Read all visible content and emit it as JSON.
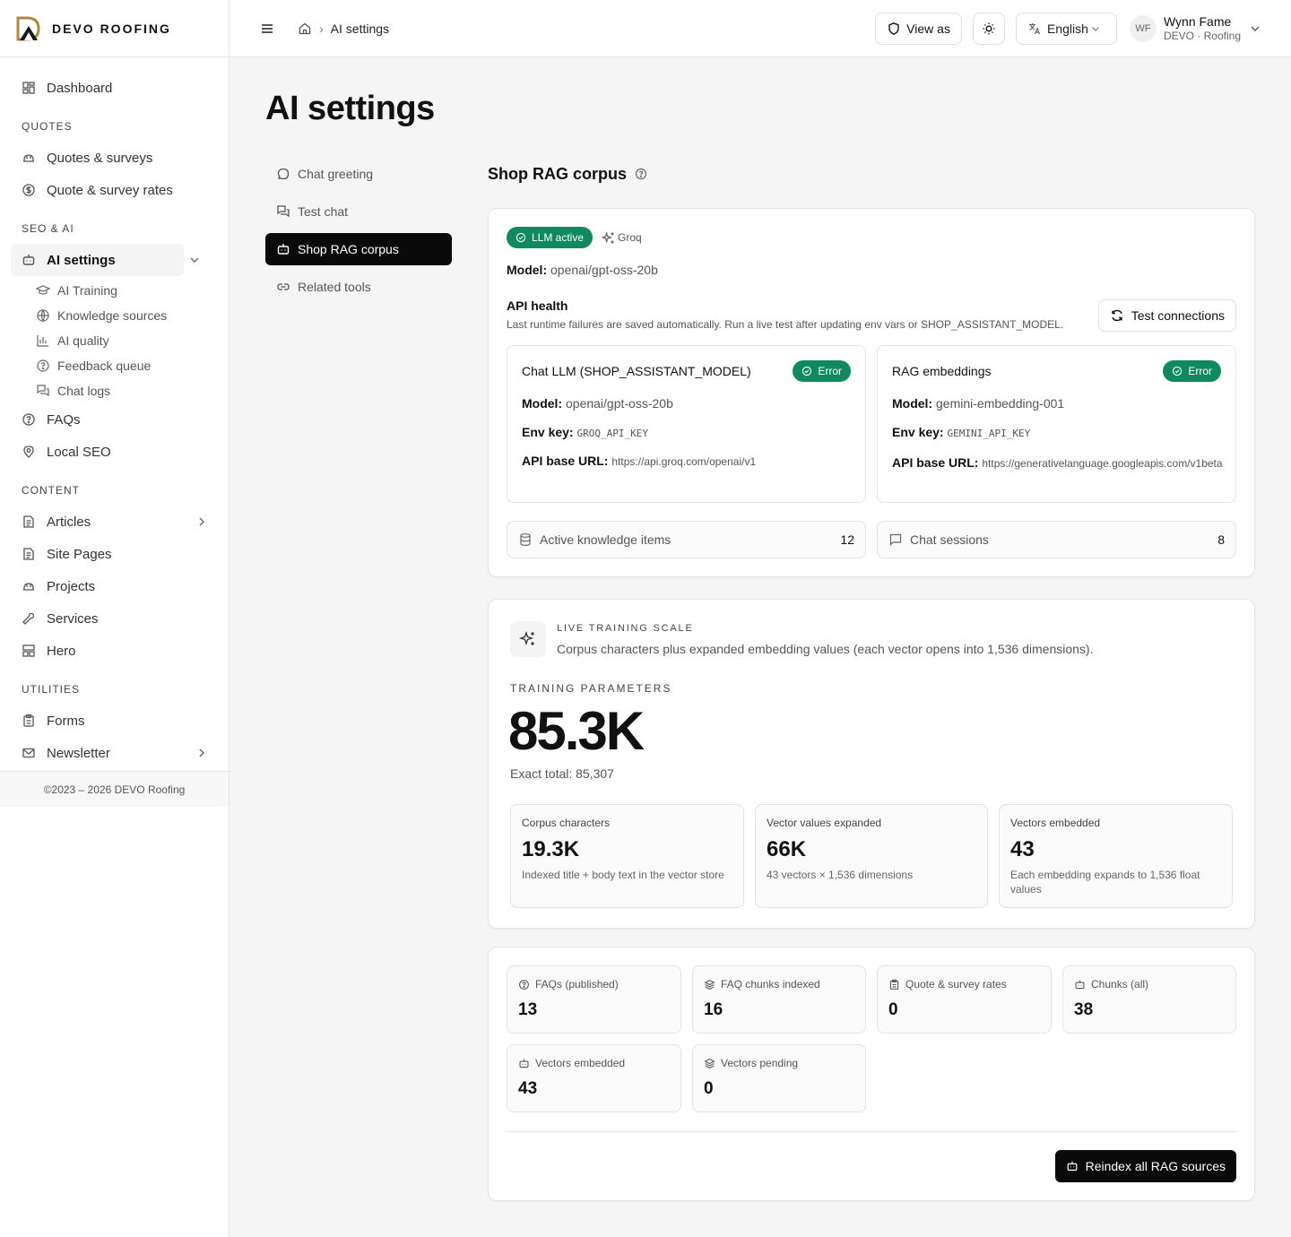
{
  "brand": {
    "name": "DEVO ROOFING"
  },
  "header": {
    "breadcrumb_current": "AI settings",
    "view_as_label": "View as",
    "language": "English",
    "user": {
      "initials": "WF",
      "name": "Wynn Fame",
      "org": "DEVO · Roofing"
    }
  },
  "sidebar": {
    "dashboard": "Dashboard",
    "sections": {
      "quotes": "QUOTES",
      "seo_ai": "SEO & AI",
      "content": "CONTENT",
      "utilities": "UTILITIES"
    },
    "quotes_items": [
      "Quotes & surveys",
      "Quote & survey rates"
    ],
    "ai_settings": "AI settings",
    "ai_sub": [
      "AI Training",
      "Knowledge sources",
      "AI quality",
      "Feedback queue",
      "Chat logs"
    ],
    "seo_items": [
      "FAQs",
      "Local SEO"
    ],
    "content_items": [
      "Articles",
      "Site Pages",
      "Projects",
      "Services",
      "Hero"
    ],
    "utilities_items": [
      "Forms",
      "Newsletter"
    ],
    "footer": "©2023 – 2026 DEVO Roofing"
  },
  "page": {
    "title": "AI settings",
    "subnav": [
      "Chat greeting",
      "Test chat",
      "Shop RAG corpus",
      "Related tools"
    ]
  },
  "rag": {
    "section_title": "Shop RAG corpus",
    "status_pill": "LLM active",
    "provider": "Groq",
    "model_label": "Model:",
    "model_value": "openai/gpt-oss-20b",
    "api_health_title": "API health",
    "api_health_desc": "Last runtime failures are saved automatically. Run a live test after updating env vars or SHOP_ASSISTANT_MODEL.",
    "test_button": "Test connections",
    "chat_llm": {
      "title": "Chat LLM (SHOP_ASSISTANT_MODEL)",
      "status": "Error",
      "model_label": "Model:",
      "model": "openai/gpt-oss-20b",
      "env_label": "Env key:",
      "env": "GROQ_API_KEY",
      "url_label": "API base URL:",
      "url": "https://api.groq.com/openai/v1"
    },
    "embeddings": {
      "title": "RAG embeddings",
      "status": "Error",
      "model_label": "Model:",
      "model": "gemini-embedding-001",
      "env_label": "Env key:",
      "env": "GEMINI_API_KEY",
      "url_label": "API base URL:",
      "url": "https://generativelanguage.googleapis.com/v1beta"
    },
    "active_items_label": "Active knowledge items",
    "active_items": "12",
    "chat_sessions_label": "Chat sessions",
    "chat_sessions": "8"
  },
  "training": {
    "eyebrow": "LIVE TRAINING SCALE",
    "desc": "Corpus characters plus expanded embedding values (each vector opens into 1,536 dimensions).",
    "params_label": "TRAINING PARAMETERS",
    "params_value": "85.3K",
    "exact_total": "Exact total: 85,307",
    "boxes": [
      {
        "label": "Corpus characters",
        "value": "19.3K",
        "desc": "Indexed title + body text in the vector store"
      },
      {
        "label": "Vector values expanded",
        "value": "66K",
        "desc": "43 vectors × 1,536 dimensions"
      },
      {
        "label": "Vectors embedded",
        "value": "43",
        "desc": "Each embedding expands to 1,536 float values"
      }
    ]
  },
  "stats": {
    "items": [
      {
        "label": "FAQs (published)",
        "value": "13",
        "icon": "help-circle-icon"
      },
      {
        "label": "FAQ chunks indexed",
        "value": "16",
        "icon": "layers-icon"
      },
      {
        "label": "Quote & survey rates",
        "value": "0",
        "icon": "clipboard-icon"
      },
      {
        "label": "Chunks (all)",
        "value": "38",
        "icon": "bot-icon"
      },
      {
        "label": "Vectors embedded",
        "value": "43",
        "icon": "bot-icon"
      },
      {
        "label": "Vectors pending",
        "value": "0",
        "icon": "layers-icon"
      }
    ],
    "reindex_button": "Reindex all RAG sources"
  },
  "colors": {
    "accent_green": "#0f8a5f",
    "dark": "#0a0a0a"
  }
}
